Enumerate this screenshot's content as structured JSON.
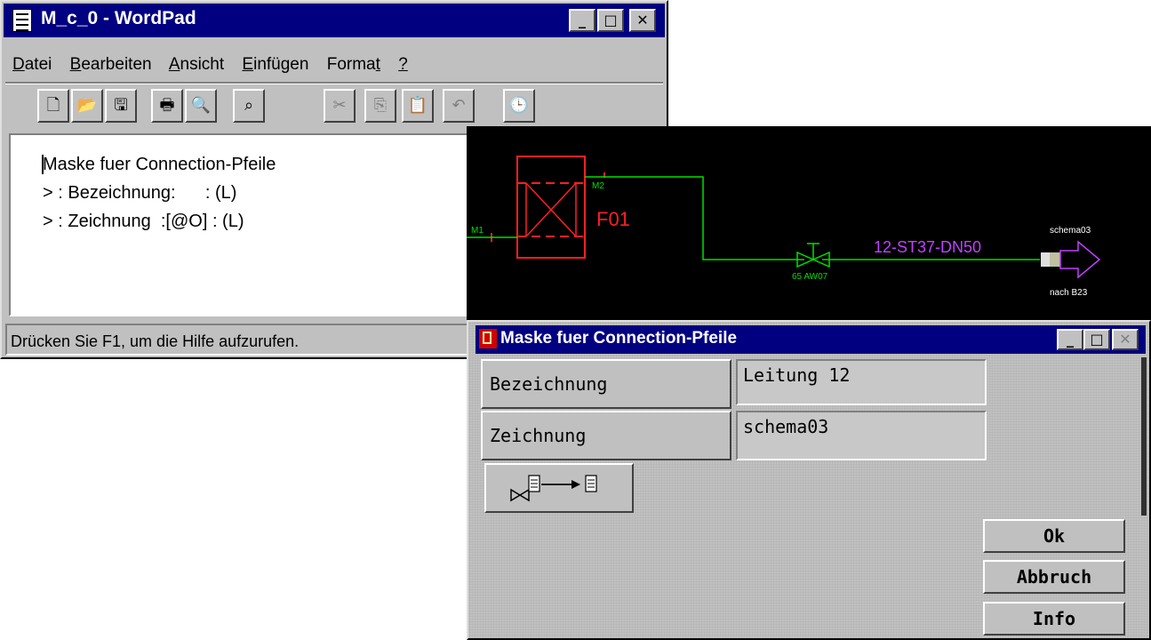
{
  "wordpad": {
    "title": "M_c_0 - WordPad",
    "caption_buttons": [
      "_",
      "□",
      "✕"
    ],
    "menu": [
      {
        "label": "Datei",
        "underline": "D"
      },
      {
        "label": "Bearbeiten",
        "underline": "B"
      },
      {
        "label": "Ansicht",
        "underline": "A"
      },
      {
        "label": "Einfügen",
        "underline": "E"
      },
      {
        "label": "Format",
        "underline": "t"
      },
      {
        "label": "?",
        "underline": "?"
      }
    ],
    "toolbar_icons": [
      "new-document-icon",
      "open-folder-icon",
      "save-icon",
      "print-icon",
      "print-preview-icon",
      "find-binoculars-icon",
      "cut-scissors-icon",
      "copy-icon",
      "paste-icon",
      "undo-icon",
      "insert-date-time-icon"
    ],
    "document_lines": [
      "Maske fuer Connection-Pfeile",
      "> : Bezeichnung:      : (L)",
      "> : Zeichnung  :[@O] : (L)"
    ],
    "status": "Drücken Sie F1, um die Hilfe aufzurufen."
  },
  "drawing": {
    "labels": {
      "m2": "M2",
      "m1": "M1",
      "equipment": "F01",
      "valve": "65 AW07",
      "pipe": "12-ST37-DN50",
      "target_schema": "schema03",
      "target_sheet": "nach B23"
    },
    "colors": {
      "equipment": "#ff2020",
      "pipe": "#00e000",
      "pipe_label": "#c040ff",
      "text_small": "#ffffff"
    }
  },
  "dialog": {
    "title": "Maske fuer Connection-Pfeile",
    "caption_buttons": [
      "_",
      "□",
      "✕"
    ],
    "rows": [
      {
        "label": "Bezeichnung",
        "value": "Leitung 12"
      },
      {
        "label": "Zeichnung",
        "value": "schema03"
      }
    ],
    "connect_icon": "valve-to-sheet-connection-icon",
    "buttons": {
      "ok": "Ok",
      "cancel": "Abbruch",
      "info": "Info"
    }
  }
}
